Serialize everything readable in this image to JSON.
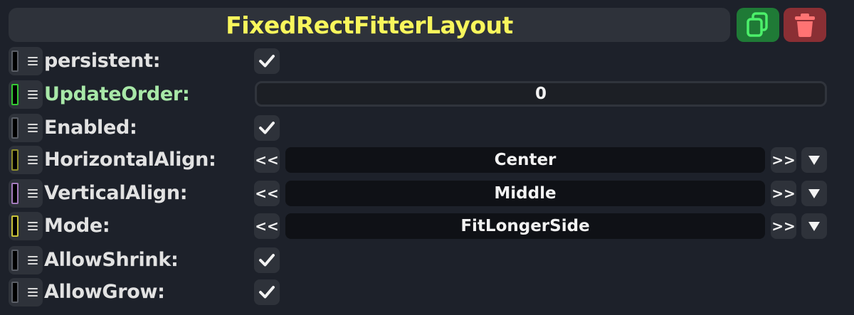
{
  "header": {
    "title": "FixedRectFitterLayout",
    "duplicate_icon": "copy-icon",
    "delete_icon": "trash-icon",
    "duplicate_color": "#1f7a36",
    "delete_color": "#8a2f34",
    "title_color": "#f8f65c"
  },
  "fields": {
    "persistent": {
      "label": "persistent:",
      "checked": true,
      "swatch": "#5a5e66"
    },
    "update_order": {
      "label": "UpdateOrder:",
      "value": "0",
      "swatch": "#35c935"
    },
    "enabled": {
      "label": "Enabled:",
      "checked": true,
      "swatch": "#5a5e66"
    },
    "horizontal_align": {
      "label": "HorizontalAlign:",
      "value": "Center",
      "prev": "<<",
      "next": ">>",
      "swatch": "#c9c93a"
    },
    "vertical_align": {
      "label": "VerticalAlign:",
      "value": "Middle",
      "prev": "<<",
      "next": ">>",
      "swatch": "#c58ae0"
    },
    "mode": {
      "label": "Mode:",
      "value": "FitLongerSide",
      "prev": "<<",
      "next": ">>",
      "swatch": "#e6e04a"
    },
    "allow_shrink": {
      "label": "AllowShrink:",
      "checked": true,
      "swatch": "#5a5e66"
    },
    "allow_grow": {
      "label": "AllowGrow:",
      "checked": true,
      "swatch": "#5a5e66"
    }
  },
  "icons": {
    "checkbox": "checkmark-icon",
    "drag_handle": "grip-lines-icon",
    "dropdown": "triangle-down-icon"
  }
}
